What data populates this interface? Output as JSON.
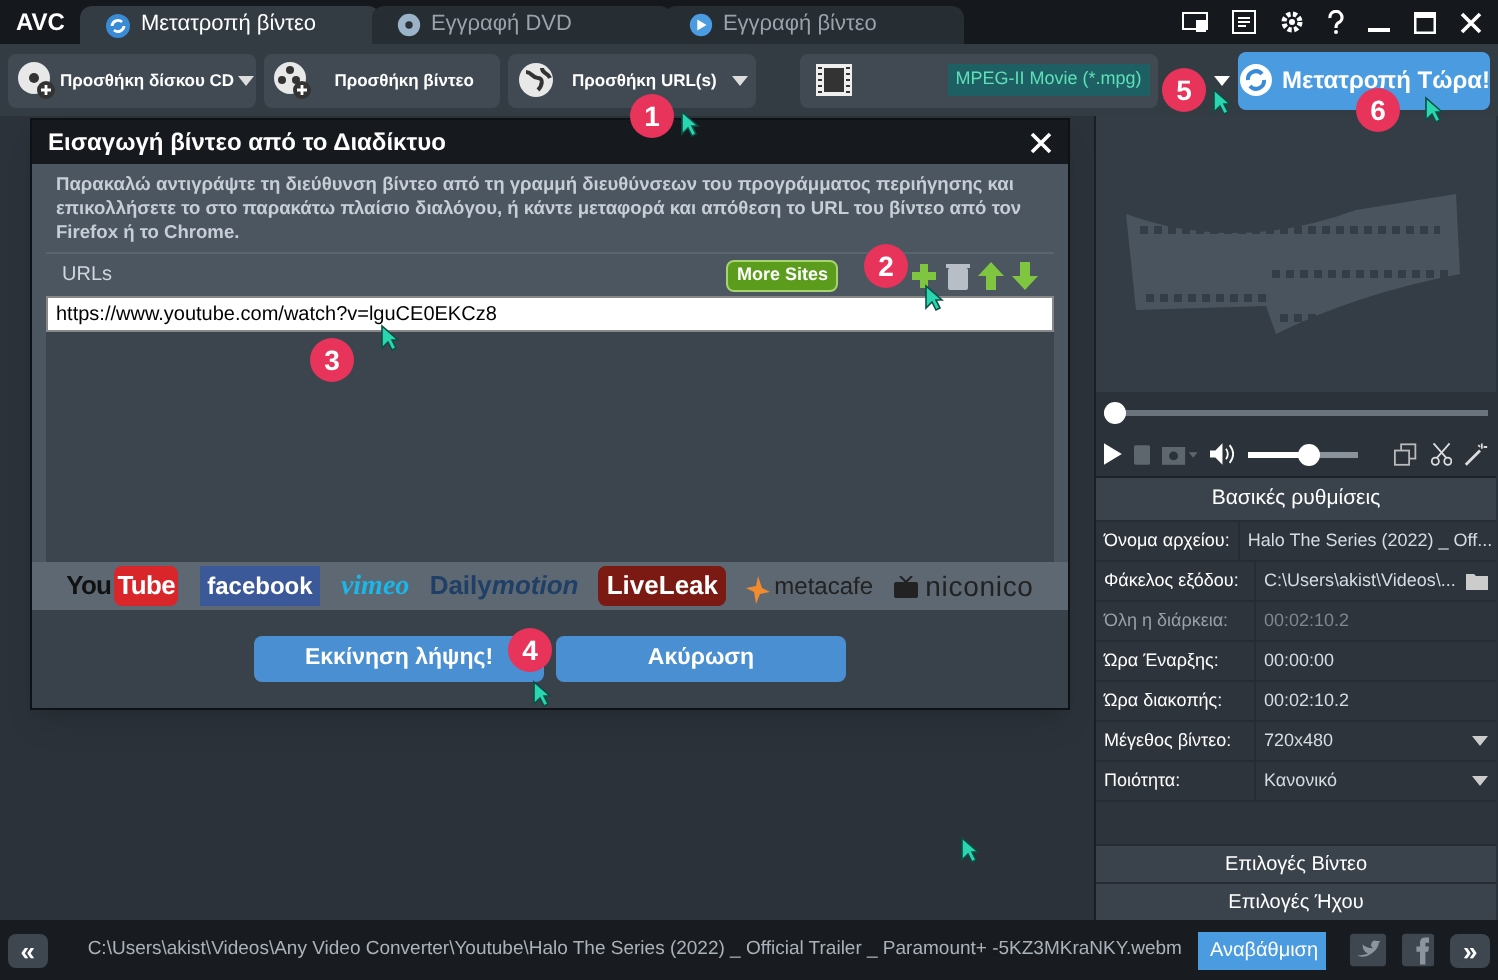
{
  "app_logo": "AVC",
  "tabs": [
    {
      "label": "Μετατροπή βίντεο",
      "selected": true,
      "kind": "convert"
    },
    {
      "label": "Εγγραφή DVD",
      "selected": false,
      "kind": "disc"
    },
    {
      "label": "Εγγραφή βίντεο",
      "selected": false,
      "kind": "record"
    }
  ],
  "toolbar": {
    "buttons": [
      {
        "label": "Προσθήκη δίσκου CD",
        "kind": "disc",
        "dropdown": true
      },
      {
        "label": "Προσθήκη βίντεο",
        "kind": "video",
        "dropdown": false
      },
      {
        "label": "Προσθήκη URL(s)",
        "kind": "web",
        "dropdown": true
      }
    ],
    "format": "MPEG-II Movie (*.mpg)",
    "convert": "Μετατροπή Τώρα!"
  },
  "dialog": {
    "title": "Εισαγωγή βίντεο από το Διαδίκτυο",
    "message": "Παρακαλώ αντιγράψτε τη διεύθυνση βίντεο από τη γραμμή διευθύνσεων του προγράμματος περιήγησης και επικολλήσετε το στο παρακάτω πλαίσιο διαλόγου, ή κάντε μεταφορά και απόθεση το URL του βίντεο από τον Firefox ή το Chrome.",
    "urls_label": "URLs",
    "more_sites": "More Sites",
    "url_value": "https://www.youtube.com/watch?v=lguCE0EKCz8",
    "sites": [
      {
        "kind": "youtube",
        "parts": [
          "You",
          "Tube"
        ]
      },
      {
        "kind": "facebook",
        "parts": [
          "facebook"
        ]
      },
      {
        "kind": "vimeo",
        "parts": [
          "vimeo"
        ]
      },
      {
        "kind": "dailymotion",
        "parts": [
          "Daily",
          "motion"
        ]
      },
      {
        "kind": "liveleak",
        "parts": [
          "LiveLeak"
        ]
      },
      {
        "kind": "metacafe",
        "parts": [
          "metacafe"
        ]
      },
      {
        "kind": "niconico",
        "parts": [
          "niconico"
        ]
      }
    ],
    "buttons": [
      "Εκκίνηση λήψης!",
      "Ακύρωση"
    ]
  },
  "player": {
    "progress": {
      "level": 0
    },
    "volume": {
      "level": 0.55
    }
  },
  "settings": {
    "title": "Βασικές ρυθμίσεις",
    "rows": [
      {
        "label": "Όνομα αρχείου:",
        "value": "Halo The Series (2022) _ Off...",
        "kind": "text",
        "disabled": false
      },
      {
        "label": "Φάκελος εξόδου:",
        "value": "C:\\Users\\akist\\Videos\\...",
        "kind": "folder",
        "disabled": false
      },
      {
        "label": "Όλη η διάρκεια:",
        "value": "00:02:10.2",
        "kind": "text",
        "disabled": true
      },
      {
        "label": "Ώρα Έναρξης:",
        "value": "00:00:00",
        "kind": "text",
        "disabled": false
      },
      {
        "label": "Ώρα διακοπής:",
        "value": "00:02:10.2",
        "kind": "text",
        "disabled": false
      },
      {
        "label": "Μέγεθος βίντεο:",
        "value": "720x480",
        "kind": "select",
        "disabled": false
      },
      {
        "label": "Ποιότητα:",
        "value": "Κανονικό",
        "kind": "select",
        "disabled": false
      }
    ],
    "sections": [
      "Επιλογές Βίντεο",
      "Επιλογές Ήχου"
    ]
  },
  "status_bar": {
    "prev": "«",
    "path": "C:\\Users\\akist\\Videos\\Any Video Converter\\Youtube\\Halo The Series (2022) _ Official Trailer _ Paramount+ -5KZ3MKraNKY.webm",
    "upgrade": "Αναβάθμιση",
    "next": "»"
  },
  "annotations": [
    "1",
    "2",
    "3",
    "4",
    "5",
    "6"
  ]
}
